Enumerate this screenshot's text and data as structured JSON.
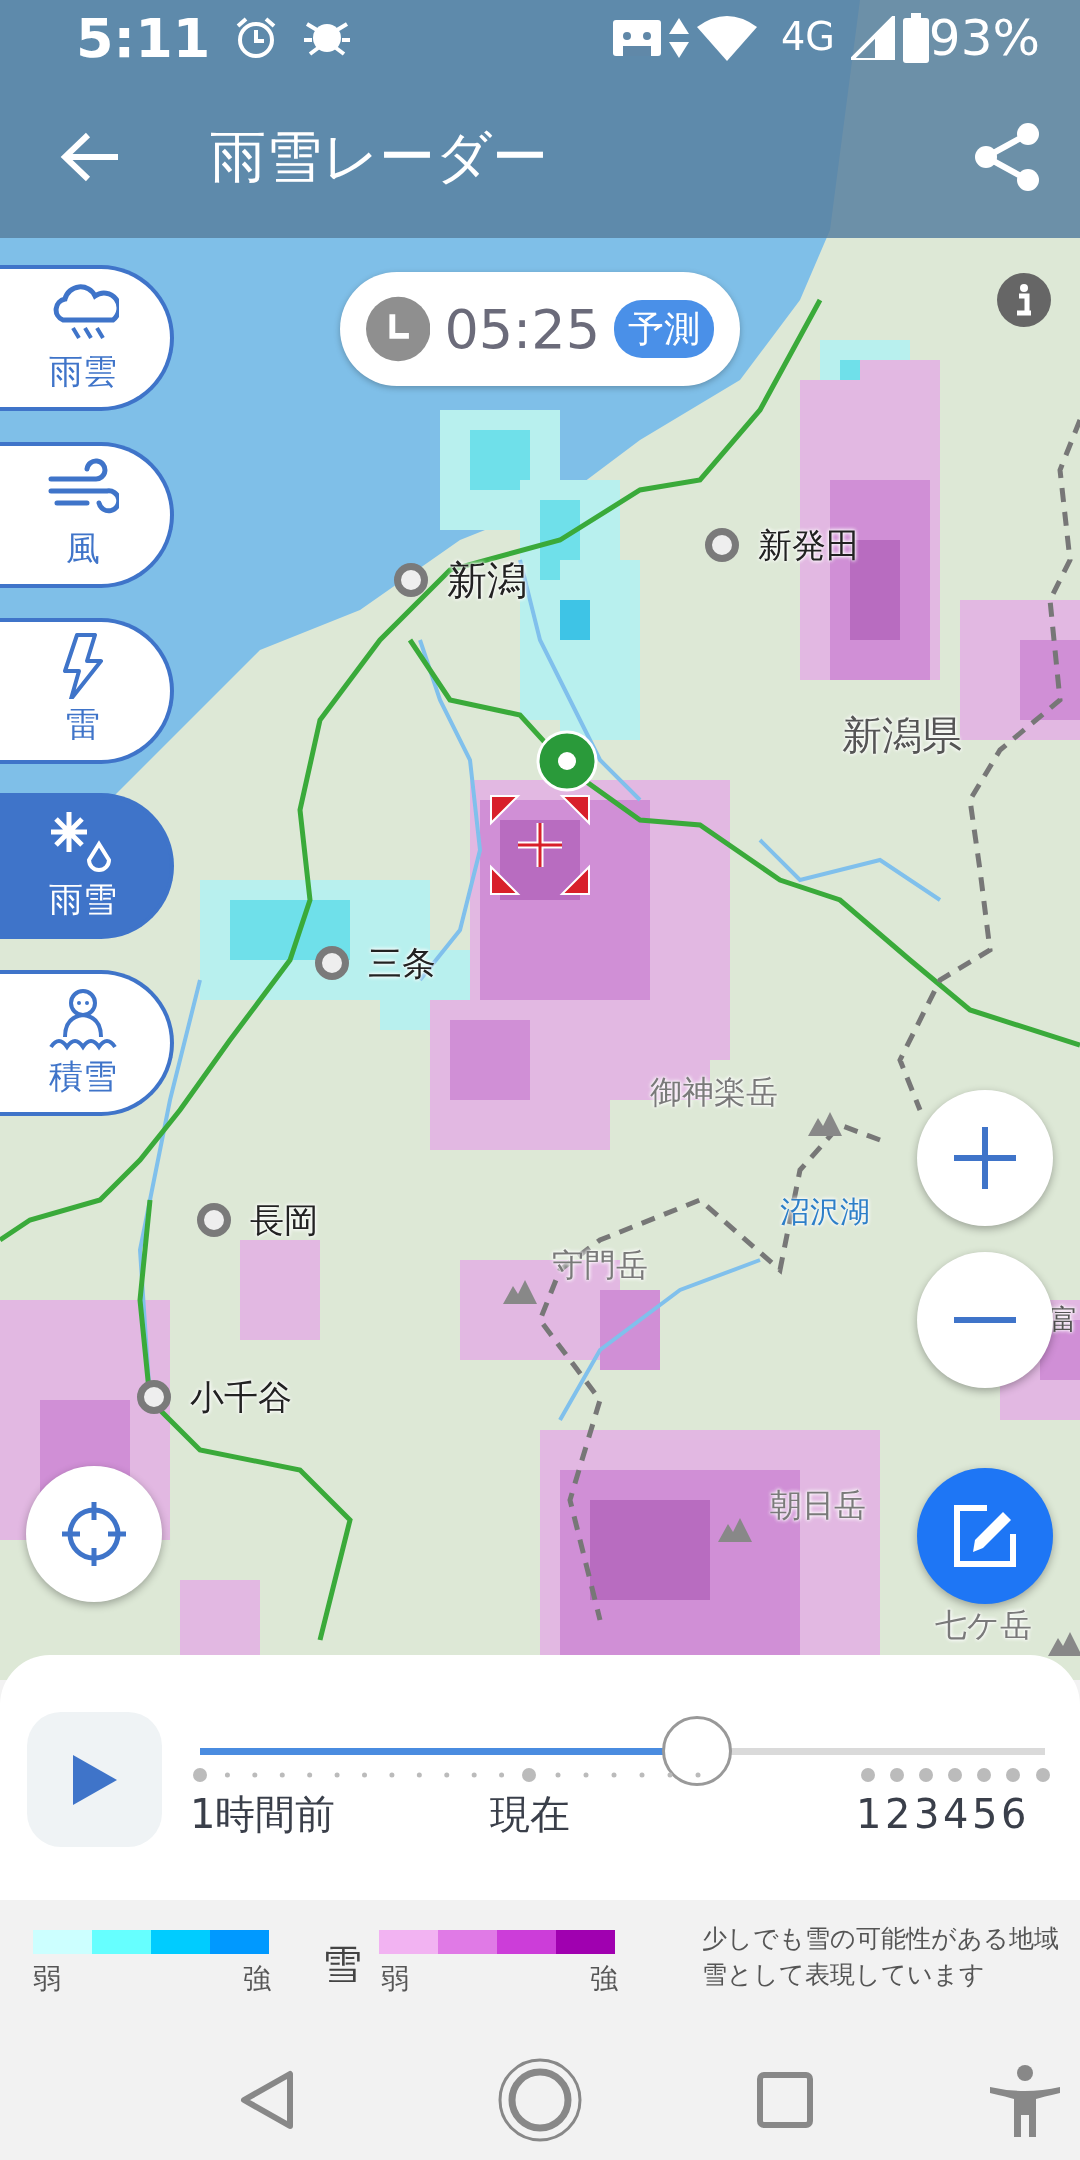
{
  "status_bar": {
    "time": "5:11",
    "network": "4G",
    "battery": "93%"
  },
  "header": {
    "title": "雨雪レーダー"
  },
  "time_pill": {
    "time": "05:25",
    "badge": "予測"
  },
  "layers": [
    {
      "kind": "rain",
      "label": "雨雲",
      "selected": false
    },
    {
      "kind": "wind",
      "label": "風",
      "selected": false
    },
    {
      "kind": "thunder",
      "label": "雷",
      "selected": false
    },
    {
      "kind": "snow",
      "label": "雨雪",
      "selected": true
    },
    {
      "kind": "snowcover",
      "label": "積雪",
      "selected": false
    }
  ],
  "map": {
    "places": [
      {
        "kind": "city",
        "label": "新発田"
      },
      {
        "kind": "city",
        "label": "新潟"
      },
      {
        "kind": "region",
        "label": "新潟県"
      },
      {
        "kind": "city",
        "label": "三条"
      },
      {
        "kind": "mountain",
        "label": "御神楽岳"
      },
      {
        "kind": "city",
        "label": "長岡"
      },
      {
        "kind": "lake",
        "label": "沼沢湖"
      },
      {
        "kind": "mountain",
        "label": "守門岳"
      },
      {
        "kind": "region",
        "label": "富"
      },
      {
        "kind": "city",
        "label": "小千谷"
      },
      {
        "kind": "mountain",
        "label": "朝日岳"
      },
      {
        "kind": "mountain",
        "label": "七ケ岳"
      }
    ]
  },
  "timeline": {
    "level": 0.588,
    "start_label": "1時間前",
    "now_label": "現在",
    "hour_labels": [
      "1",
      "2",
      "3",
      "4",
      "5",
      "6"
    ]
  },
  "legend": {
    "rain": {
      "swatches": [
        {
          "color": "#ccffff"
        },
        {
          "color": "#66ffff"
        },
        {
          "color": "#00ccff"
        },
        {
          "color": "#0099ff"
        }
      ],
      "low": "弱",
      "high": "強"
    },
    "snow": {
      "label": "雪",
      "swatches": [
        {
          "color": "#f2b3f2"
        },
        {
          "color": "#e07ae6"
        },
        {
          "color": "#cc3dd9"
        },
        {
          "color": "#a000b0"
        }
      ],
      "low": "弱",
      "high": "強"
    },
    "note": [
      "少しでも雪の可能性がある地域",
      "雪として表現しています"
    ]
  }
}
